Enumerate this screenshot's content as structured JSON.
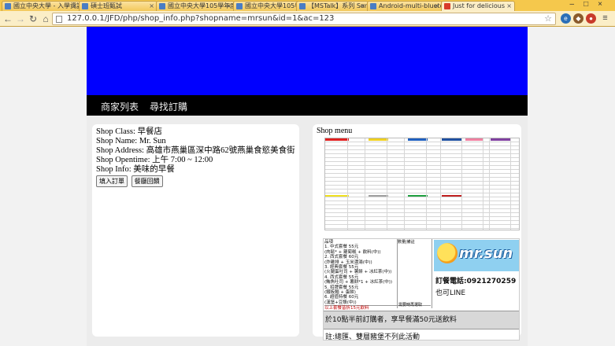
{
  "browser": {
    "tabs": [
      {
        "label": "國立中央大學 - 入學資訊"
      },
      {
        "label": "碩士班甄試"
      },
      {
        "label": "國立中央大學105學年度研..."
      },
      {
        "label": "國立中央大學105學年度研..."
      },
      {
        "label": "【MSTalk】系列 Sona..."
      },
      {
        "label": "Android-multi-bluetooth..."
      },
      {
        "label": "Just for delicious"
      }
    ],
    "url": "127.0.0.1/JFD/php/shop_info.php?shopname=mrsun&id=1&ac=123",
    "back_icon": "arrow-left-icon",
    "forward_icon": "arrow-right-icon",
    "reload_icon": "reload-icon",
    "home_icon": "home-icon",
    "star_icon": "star-icon",
    "menu_icon": "hamburger-icon"
  },
  "nav": {
    "items": [
      {
        "label": "商家列表"
      },
      {
        "label": "尋找訂購"
      }
    ]
  },
  "shop": {
    "class_line": "Shop Class: 早餐店",
    "name_line": "Shop Name: Mr. Sun",
    "address_line": "Shop Address: 高雄市燕巢區深中路62號燕巢食慾美食街",
    "opentime_line": "Shop Opentime: 上午 7:00 ~ 12:00",
    "info_line": "Shop Info: 美味的早餐",
    "buttons": {
      "order": "填入訂單",
      "feedback": "餐廳回饋"
    }
  },
  "menu": {
    "title": "Shop menu",
    "flyer": {
      "header_item": "品項",
      "header_price": "數量|備註",
      "lines": [
        "1. 中式套餐 55元",
        "(肉鬆* + 蘿蔔糕 + 飲料(中))",
        "2. 西式套餐 60元",
        "(炸雞排 + 玉米濃湯(中))",
        "3. 經典套餐 55元",
        "(火腿蛋吐司 + 薯餅 + 冰紅茶(中))",
        "4. 西式套餐 55元",
        "(鮪魚吐司 + 薯餅*1 + 冰紅茶(中))",
        "5. 招牌套餐 55元",
        "(鐵板麵 + 蛋餅)",
        "6. 超值特餐 60元",
        "(漢堡+豆漿(中))"
      ],
      "deal_line": "以上套餐皆折15元飲料",
      "deal_note": "需要時再選取",
      "logo_text": "mr.sun",
      "phone": "訂餐電話:0921270259",
      "line_id": "也可LINE",
      "promo": "於10點半前訂購者，享早餐滿50元送飲料",
      "note": "註:總匯、雙層豬堡不列此活動"
    }
  }
}
